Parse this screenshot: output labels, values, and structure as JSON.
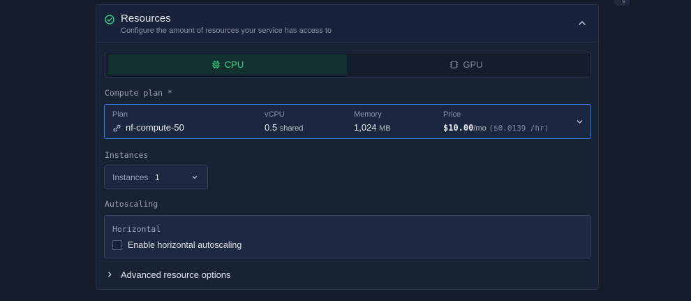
{
  "colors": {
    "accent_green": "#3fd08a",
    "focus_blue": "#3a78d8",
    "panel_bg": "#182235",
    "page_bg": "#141c2c"
  },
  "section": {
    "title": "Resources",
    "subtitle": "Configure the amount of resources your service has access to",
    "status_icon": "check-circle-icon",
    "collapse_icon": "chevron-up-icon"
  },
  "tabs": [
    {
      "label": "CPU",
      "icon": "cpu-chip-icon",
      "selected": true
    },
    {
      "label": "GPU",
      "icon": "gpu-chip-icon",
      "selected": false
    }
  ],
  "compute_plan": {
    "label": "Compute plan *",
    "plan_header": "Plan",
    "plan_value": "nf-compute-50",
    "plan_icon": "link-icon",
    "vcpu_header": "vCPU",
    "vcpu_value": "0.5",
    "vcpu_unit": "shared",
    "memory_header": "Memory",
    "memory_value": "1,024",
    "memory_unit": "MB",
    "price_header": "Price",
    "price_value": "$10.00",
    "price_unit": "/mo",
    "price_hourly": "($0.0139 /hr)"
  },
  "instances": {
    "label": "Instances",
    "select_label": "Instances",
    "select_value": "1"
  },
  "autoscaling": {
    "label": "Autoscaling",
    "box_title": "Horizontal",
    "checkbox_label": "Enable horizontal autoscaling",
    "checked": false
  },
  "advanced": {
    "label": "Advanced resource options"
  }
}
